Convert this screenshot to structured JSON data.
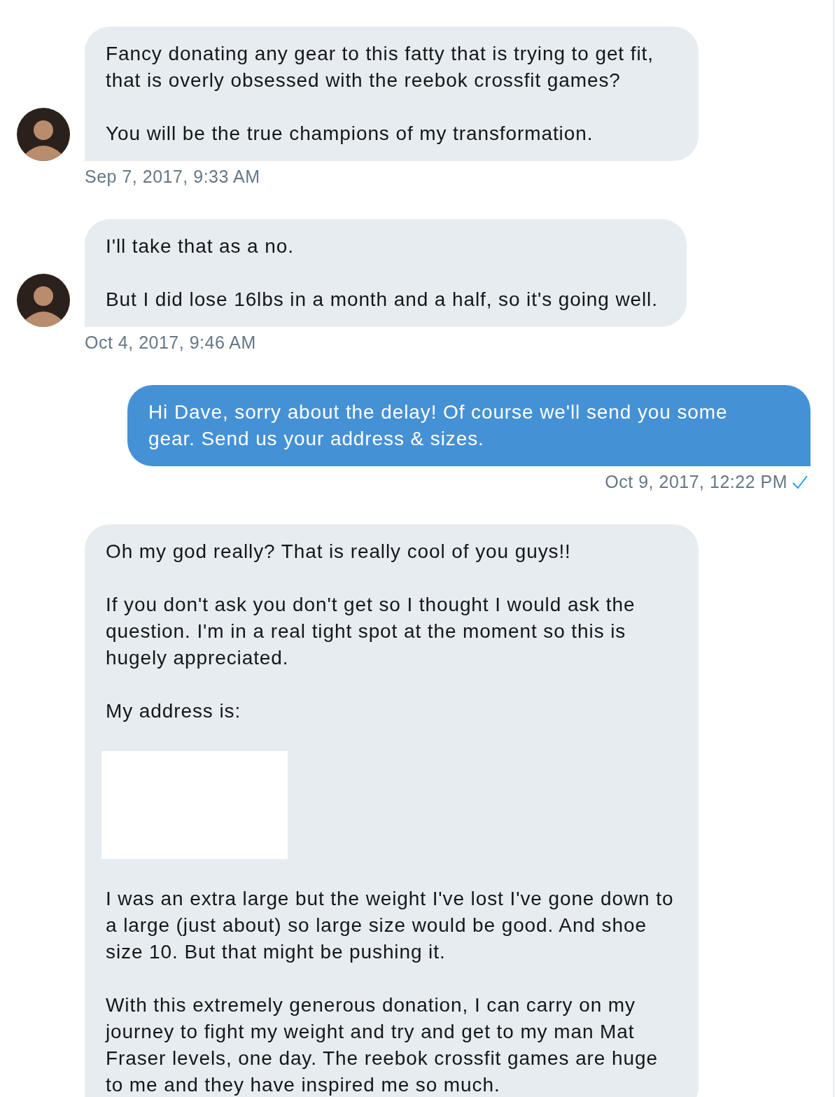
{
  "messages": [
    {
      "kind": "incoming",
      "avatar": true,
      "blocks": [
        {
          "kind": "text",
          "text": "Fancy donating any gear to this fatty that is trying to get fit, that is overly obsessed with the reebok crossfit games?"
        },
        {
          "kind": "text",
          "text": "You will be the true champions of my transformation."
        }
      ],
      "time": "Sep 7, 2017, 9:33 AM",
      "read": false
    },
    {
      "kind": "incoming",
      "avatar": true,
      "blocks": [
        {
          "kind": "text",
          "text": "I'll take that as a no."
        },
        {
          "kind": "text",
          "text": "But I did lose 16lbs in a month and a half, so it's going well."
        }
      ],
      "time": "Oct 4, 2017, 9:46 AM",
      "read": false
    },
    {
      "kind": "outgoing",
      "avatar": false,
      "blocks": [
        {
          "kind": "text",
          "text": "Hi Dave, sorry about the delay! Of course we'll send you some gear. Send us your address & sizes."
        }
      ],
      "time": "Oct 9, 2017, 12:22 PM",
      "read": true
    },
    {
      "kind": "incoming",
      "avatar": false,
      "blocks": [
        {
          "kind": "text",
          "text": "Oh my god really? That is really cool of you guys!!"
        },
        {
          "kind": "text",
          "text": "If you don't ask you don't get so I thought I would ask the question. I'm in a real tight spot at the moment so this is hugely appreciated."
        },
        {
          "kind": "text",
          "text": "My address is:"
        },
        {
          "kind": "blank"
        },
        {
          "kind": "text",
          "text": "I was an extra large but the weight I've lost I've gone down to a large (just about) so large size would be good. And shoe size 10. But that might be pushing it."
        },
        {
          "kind": "text",
          "text": "With this extremely generous donation, I can carry on my journey to fight my weight and try and get to my man Mat Fraser levels, one day. The reebok crossfit games are huge to me and they have inspired me so much."
        }
      ],
      "read": false
    }
  ]
}
